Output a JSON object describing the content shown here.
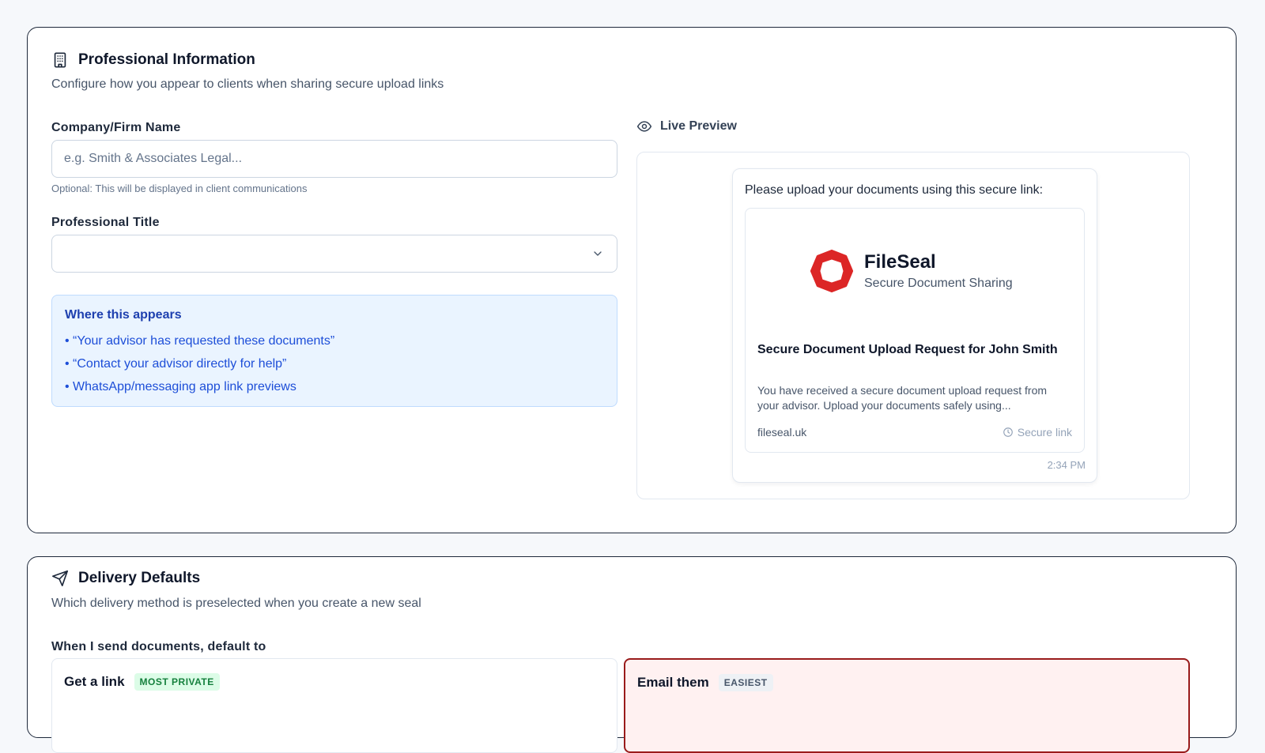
{
  "professional": {
    "title": "Professional Information",
    "subtitle": "Configure how you appear to clients when sharing secure upload links",
    "company_label": "Company/Firm Name",
    "company_placeholder": "e.g. Smith & Associates Legal...",
    "company_value": "",
    "company_hint": "Optional: This will be displayed in client communications",
    "title_label": "Professional Title",
    "title_value": "",
    "info": {
      "heading": "Where this appears",
      "items": [
        "• “Your advisor has requested these documents”",
        "• “Contact your advisor directly for help”",
        "• WhatsApp/messaging app link previews"
      ]
    }
  },
  "preview": {
    "label": "Live Preview",
    "message": "Please upload your documents using this secure link:",
    "brand_name": "FileSeal",
    "brand_tagline": "Secure Document Sharing",
    "link_title": "Secure Document Upload Request for John Smith",
    "link_description": "You have received a secure document upload request from your advisor. Upload your documents safely using...",
    "domain": "fileseal.uk",
    "secure_label": "Secure link",
    "time": "2:34 PM"
  },
  "delivery": {
    "title": "Delivery Defaults",
    "subtitle": "Which delivery method is preselected when you create a new seal",
    "default_label": "When I send documents, default to",
    "options": [
      {
        "title": "Get a link",
        "badge": "MOST PRIVATE"
      },
      {
        "title": "Email them",
        "badge": "EASIEST"
      }
    ],
    "selected": "Email them"
  },
  "colors": {
    "brand_red": "#dc2626",
    "selected_border": "#991b1b",
    "info_blue": "#1d4ed8"
  },
  "icons": {
    "professional": "building-icon",
    "preview": "eye-icon",
    "delivery": "send-icon",
    "select": "chevron-down-icon",
    "secure": "clock-icon"
  }
}
